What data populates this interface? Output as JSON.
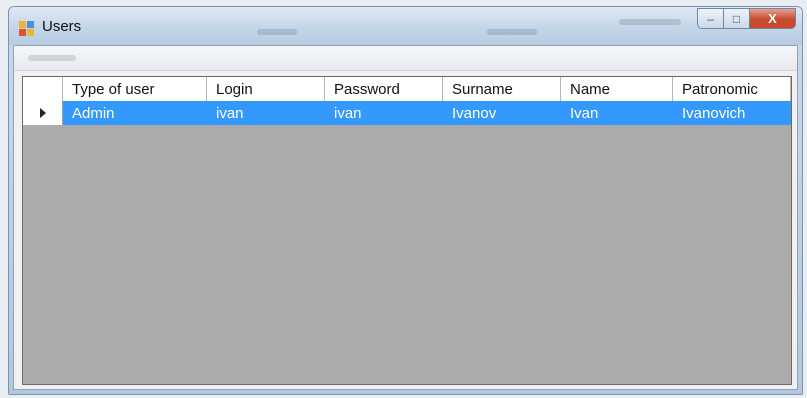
{
  "window": {
    "title": "Users",
    "buttons": {
      "minimize": "–",
      "maximize": "□",
      "close": "X"
    }
  },
  "grid": {
    "columns": [
      "Type of user",
      "Login",
      "Password",
      "Surname",
      "Name",
      "Patronomic"
    ],
    "rows": [
      [
        "Admin",
        "ivan",
        "ivan",
        "Ivanov",
        "Ivan",
        "Ivanovich"
      ]
    ],
    "selected_row": 0
  },
  "colors": {
    "selection": "#3399ff",
    "grid_background": "#ababab",
    "title_bar": "#c4d5e8"
  },
  "icons": [
    "app-icon",
    "row-pointer-icon",
    "minimize-icon",
    "maximize-icon",
    "close-icon"
  ]
}
